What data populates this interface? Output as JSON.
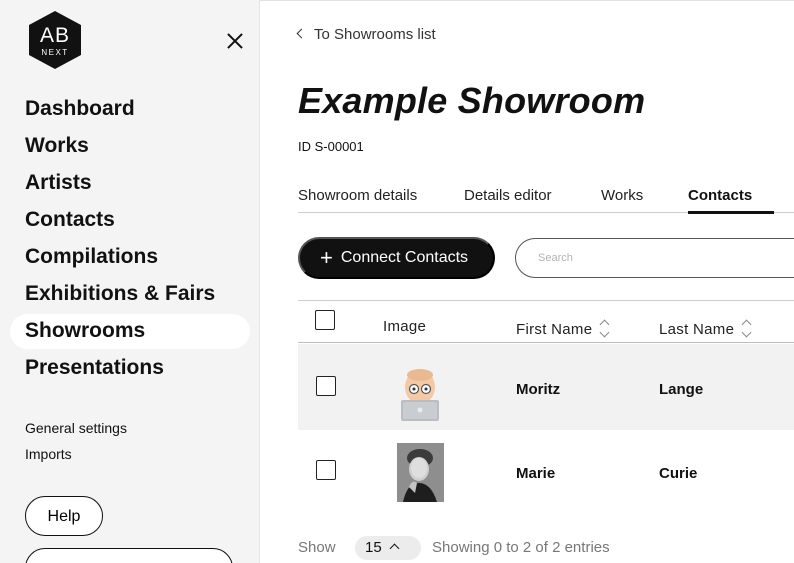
{
  "logo": {
    "top": "AB",
    "bottom": "NEXT"
  },
  "sidebar": {
    "nav": [
      {
        "label": "Dashboard"
      },
      {
        "label": "Works"
      },
      {
        "label": "Artists"
      },
      {
        "label": "Contacts"
      },
      {
        "label": "Compilations"
      },
      {
        "label": "Exhibitions & Fairs"
      },
      {
        "label": "Showrooms",
        "active": true
      },
      {
        "label": "Presentations"
      }
    ],
    "links": [
      "General settings",
      "Imports"
    ],
    "help_label": "Help"
  },
  "main": {
    "back_label": "To Showrooms list",
    "title": "Example Showroom",
    "id_text": "ID S-00001",
    "tabs": [
      "Showroom details",
      "Details editor",
      "Works",
      "Contacts"
    ],
    "active_tab": "Contacts",
    "connect_label": "Connect Contacts",
    "search_placeholder": "Search",
    "columns": [
      "Image",
      "First Name",
      "Last Name"
    ],
    "rows": [
      {
        "first_name": "Moritz",
        "last_name": "Lange",
        "avatar": "memoji-laptop-avatar"
      },
      {
        "first_name": "Marie",
        "last_name": "Curie",
        "avatar": "portrait-photo-avatar"
      }
    ],
    "footer": {
      "show_label": "Show",
      "page_size": "15",
      "info": "Showing 0 to 2 of 2 entries"
    }
  }
}
